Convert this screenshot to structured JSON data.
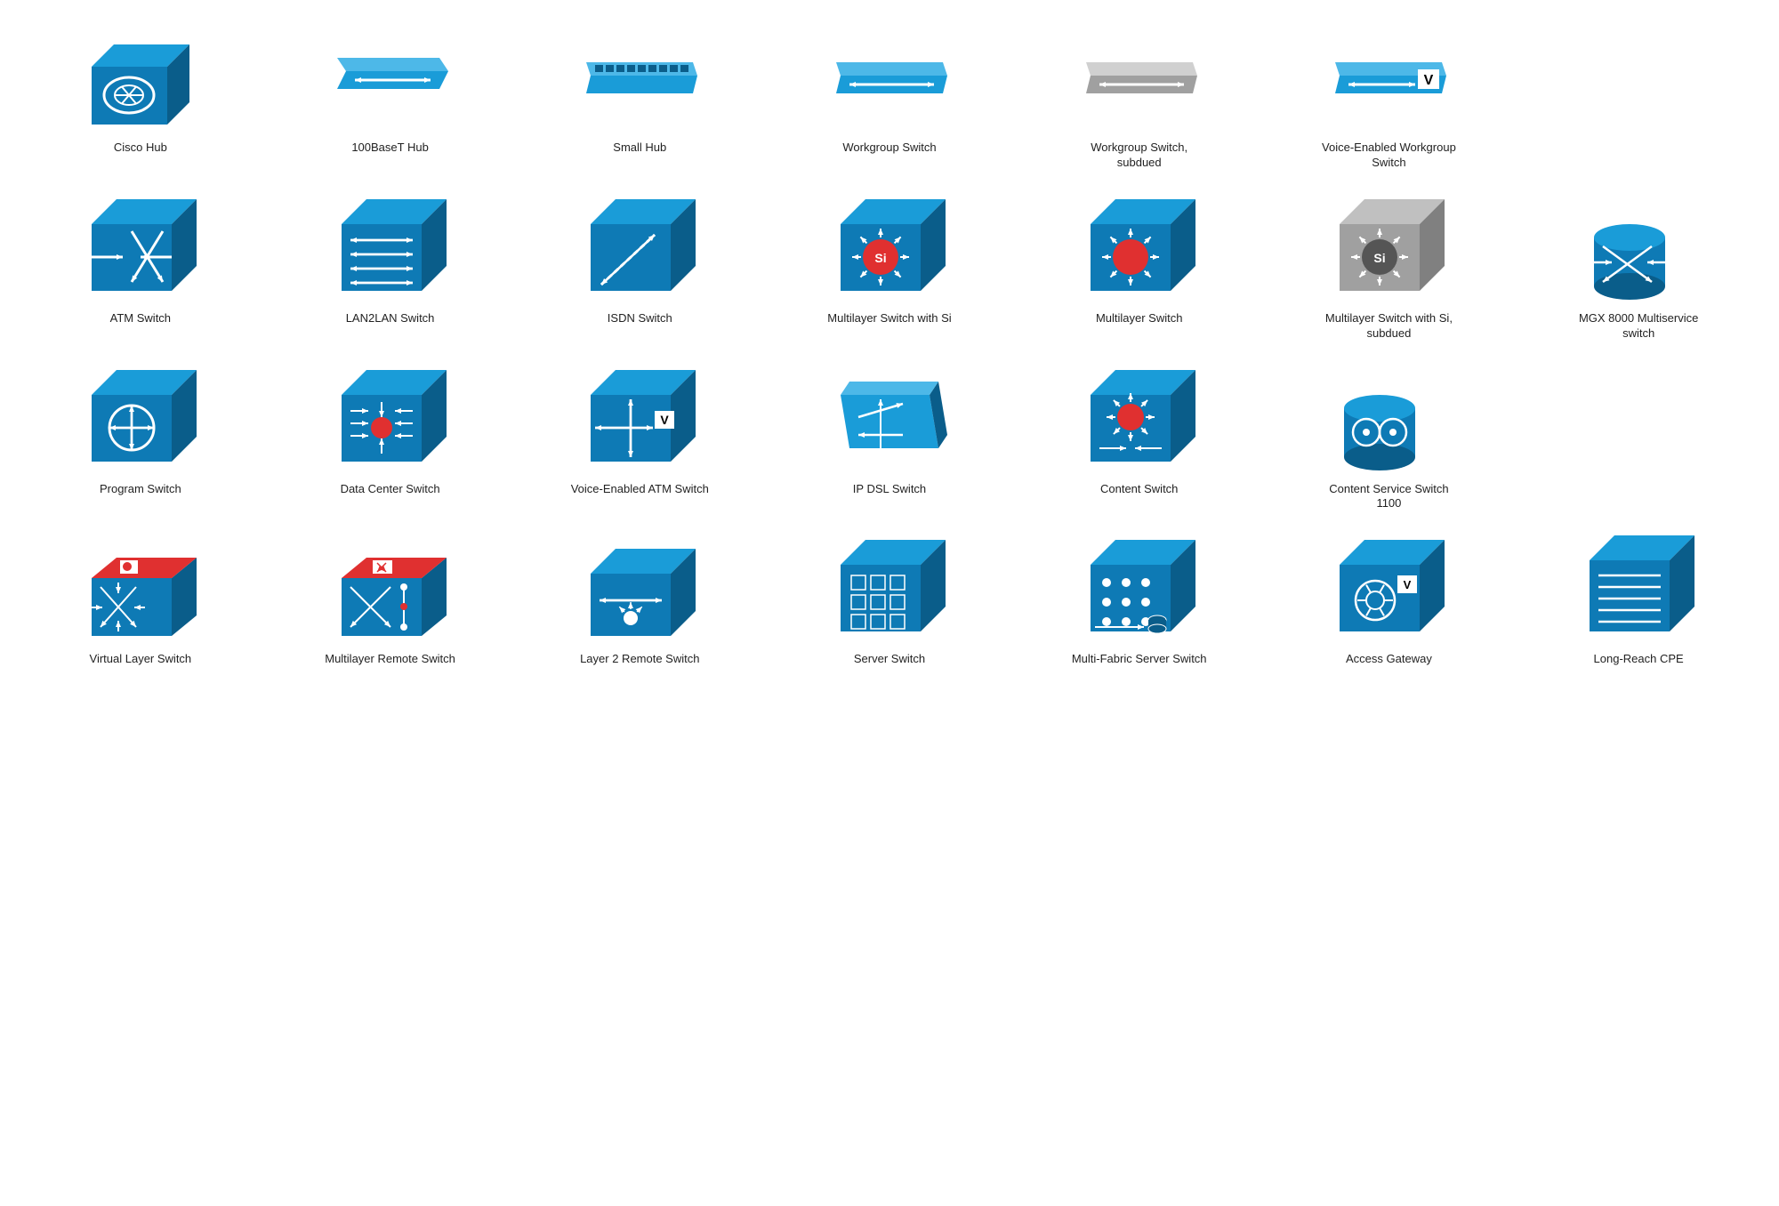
{
  "items": [
    {
      "id": "cisco-hub",
      "label": "Cisco Hub",
      "type": "cisco-hub"
    },
    {
      "id": "100baset-hub",
      "label": "100BaseT Hub",
      "type": "flat-hub-arrow"
    },
    {
      "id": "small-hub",
      "label": "Small Hub",
      "type": "small-hub"
    },
    {
      "id": "workgroup-switch",
      "label": "Workgroup Switch",
      "type": "workgroup-switch"
    },
    {
      "id": "workgroup-switch-subdued",
      "label": "Workgroup Switch, subdued",
      "type": "workgroup-switch-subdued"
    },
    {
      "id": "voice-workgroup-switch",
      "label": "Voice-Enabled Workgroup Switch",
      "type": "voice-workgroup-switch"
    },
    {
      "id": "spacer1",
      "label": "",
      "type": "spacer"
    },
    {
      "id": "atm-switch",
      "label": "ATM Switch",
      "type": "atm-switch"
    },
    {
      "id": "lan2lan-switch",
      "label": "LAN2LAN Switch",
      "type": "lan2lan-switch"
    },
    {
      "id": "isdn-switch",
      "label": "ISDN Switch",
      "type": "isdn-switch"
    },
    {
      "id": "multilayer-si",
      "label": "Multilayer Switch with Si",
      "type": "multilayer-si"
    },
    {
      "id": "multilayer-switch",
      "label": "Multilayer Switch",
      "type": "multilayer-switch"
    },
    {
      "id": "multilayer-si-subdued",
      "label": "Multilayer Switch with Si, subdued",
      "type": "multilayer-si-subdued"
    },
    {
      "id": "mgx8000",
      "label": "MGX 8000 Multiservice switch",
      "type": "mgx8000"
    },
    {
      "id": "program-switch",
      "label": "Program Switch",
      "type": "program-switch"
    },
    {
      "id": "data-center-switch",
      "label": "Data Center Switch",
      "type": "data-center-switch"
    },
    {
      "id": "voice-atm-switch",
      "label": "Voice-Enabled ATM Switch",
      "type": "voice-atm-switch"
    },
    {
      "id": "ip-dsl-switch",
      "label": "IP DSL Switch",
      "type": "ip-dsl-switch"
    },
    {
      "id": "content-switch",
      "label": "Content Switch",
      "type": "content-switch"
    },
    {
      "id": "content-service-1100",
      "label": "Content Service Switch 1100",
      "type": "content-service-1100"
    },
    {
      "id": "spacer2",
      "label": "",
      "type": "spacer"
    },
    {
      "id": "virtual-layer-switch",
      "label": "Virtual Layer Switch",
      "type": "virtual-layer-switch"
    },
    {
      "id": "multilayer-remote-switch",
      "label": "Multilayer Remote Switch",
      "type": "multilayer-remote-switch"
    },
    {
      "id": "layer2-remote-switch",
      "label": "Layer 2 Remote Switch",
      "type": "layer2-remote-switch"
    },
    {
      "id": "server-switch",
      "label": "Server Switch",
      "type": "server-switch"
    },
    {
      "id": "multi-fabric-server",
      "label": "Multi-Fabric Server Switch",
      "type": "multi-fabric-server"
    },
    {
      "id": "access-gateway",
      "label": "Access Gateway",
      "type": "access-gateway"
    },
    {
      "id": "long-reach-cpe",
      "label": "Long-Reach CPE",
      "type": "long-reach-cpe"
    }
  ]
}
